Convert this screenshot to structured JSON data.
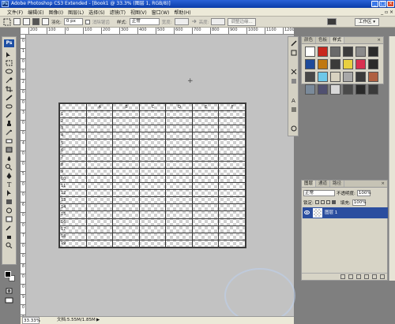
{
  "window": {
    "title": "Adobe Photoshop CS3 Extended - [Book1 @ 33.3% (图层 1, RGB/8)]",
    "app_icon": "Ps",
    "min": "_",
    "max": "□",
    "close": "×"
  },
  "menu": {
    "items": [
      "文件(F)",
      "编辑(E)",
      "图像(I)",
      "图层(L)",
      "选择(S)",
      "滤镜(T)",
      "视图(V)",
      "窗口(W)",
      "帮助(H)"
    ],
    "right_controls": "_ ▫ ×"
  },
  "options": {
    "feather_label": "羽化:",
    "feather_value": "0 px",
    "antialias_label": "消除锯齿",
    "style_label": "样式:",
    "style_value": "正常",
    "width_label": "宽度:",
    "height_label": "高度:",
    "refine_edge": "调整边缘...",
    "workspace": "工作区 ▾"
  },
  "toolbox": {
    "logo": "Ps"
  },
  "ruler": {
    "h": [
      "200",
      "100",
      "0",
      "100",
      "200",
      "300",
      "400",
      "500",
      "600",
      "700",
      "800",
      "900",
      "1000",
      "1100",
      "1200"
    ],
    "v": [
      "0",
      "1",
      "0",
      "0",
      "2",
      "0",
      "0",
      "3",
      "0",
      "0",
      "4",
      "0",
      "0",
      "5",
      "0",
      "0",
      "6",
      "0",
      "0",
      "7",
      "0",
      "0",
      "8",
      "0",
      "0",
      "9",
      "0",
      "0"
    ]
  },
  "grid": {
    "header": [
      "",
      "A",
      "B",
      "C",
      "D",
      "E",
      "F"
    ],
    "rows": [
      "1",
      "2",
      "3",
      "4",
      "5",
      "6",
      "7",
      "8",
      "9",
      "10",
      "11",
      "12",
      "13",
      "14",
      "15",
      "16",
      "17",
      "18",
      "19",
      "20"
    ]
  },
  "status": {
    "zoom": "33.33%",
    "doc": "文档:5.55M/1.85M",
    "arrow": "▶"
  },
  "swatch_panel": {
    "tabs": [
      "颜色",
      "色板",
      "样式"
    ],
    "close": "×",
    "swatches": [
      "#ffffff",
      "#c8281e",
      "#6a6a6a",
      "#3c3c3c",
      "#8a8a8a",
      "#2b2b2b",
      "#1e4a9a",
      "#c07810",
      "#3a3a3a",
      "#e8d040",
      "#d83050",
      "#2a2a2a",
      "#484848",
      "#6ec8e8",
      "#d8d2c0",
      "#a8a8a8",
      "#3a3a3a",
      "#b06040",
      "#7a8a9a",
      "#505070",
      "#d8d8d8",
      "#4a4a4a",
      "#2a2a2a",
      "#3a3a3a"
    ]
  },
  "layers_panel": {
    "tabs": [
      "图层",
      "通道",
      "路径"
    ],
    "close": "×",
    "blend_mode": "正常",
    "opacity_label": "不透明度:",
    "opacity": "100%",
    "lock_label": "锁定:",
    "fill_label": "填充:",
    "fill": "100%",
    "layer_name": "图层 1"
  }
}
